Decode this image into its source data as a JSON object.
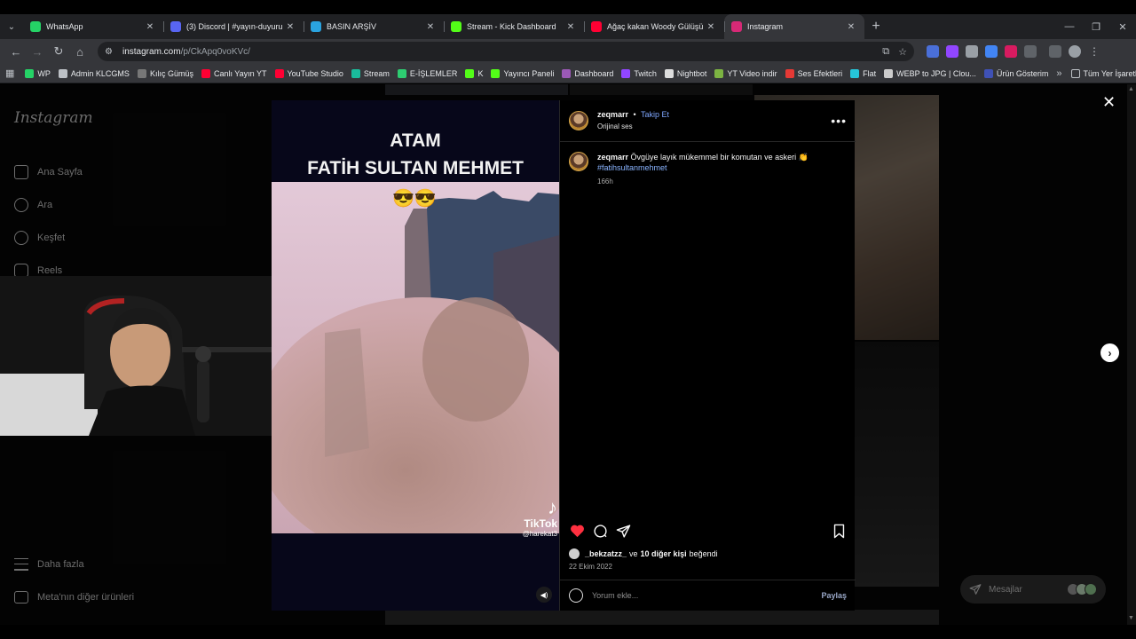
{
  "browser": {
    "tabs": [
      {
        "title": "WhatsApp",
        "icon": "whatsapp-icon",
        "color": "#25d366",
        "active": false
      },
      {
        "title": "(3) Discord | #yayın-duyuru",
        "icon": "discord-icon",
        "color": "#5865f2",
        "active": false
      },
      {
        "title": "BASIN ARŞİV",
        "icon": "telegram-icon",
        "color": "#2aa3df",
        "active": false
      },
      {
        "title": "Stream - Kick Dashboard",
        "icon": "kick-icon",
        "color": "#53fc18",
        "active": false
      },
      {
        "title": "Ağaç kakan Woody Gülüşü - Yo",
        "icon": "youtube-icon",
        "color": "#ff0033",
        "active": false
      },
      {
        "title": "Instagram",
        "icon": "instagram-icon",
        "color": "#d62976",
        "active": true
      }
    ],
    "address": {
      "host": "instagram.com",
      "path": "/p/CkApq0voKVc/"
    },
    "bookmarks": [
      {
        "label": "WP",
        "color": "#25d366"
      },
      {
        "label": "Admin KLCGMS",
        "color": "#bdc1c6"
      },
      {
        "label": "Kılıç Gümüş",
        "color": "#777777"
      },
      {
        "label": "Canlı Yayın YT",
        "color": "#ff0033"
      },
      {
        "label": "YouTube Studio",
        "color": "#ff0033"
      },
      {
        "label": "Stream",
        "color": "#1abc9c"
      },
      {
        "label": "E-İŞLEMLER",
        "color": "#2ecc71"
      },
      {
        "label": "K",
        "color": "#53fc18"
      },
      {
        "label": "Yayıncı Paneli",
        "color": "#53fc18"
      },
      {
        "label": "Dashboard",
        "color": "#9b59b6"
      },
      {
        "label": "Twitch",
        "color": "#9146ff"
      },
      {
        "label": "Nightbot",
        "color": "#dddddd"
      },
      {
        "label": "YT Video indir",
        "color": "#7cb342"
      },
      {
        "label": "Ses Efektleri",
        "color": "#e53935"
      },
      {
        "label": "Flat",
        "color": "#26c6da"
      },
      {
        "label": "WEBP to JPG | Clou...",
        "color": "#cccccc"
      },
      {
        "label": "Ürün Gösterim",
        "color": "#3f51b5"
      }
    ],
    "bookmarks_more": "»",
    "all_bookmarks": "Tüm Yer İşaretleri"
  },
  "instagram": {
    "logo": "Instagram",
    "nav": [
      {
        "label": "Ana Sayfa",
        "icon": "home-icon"
      },
      {
        "label": "Ara",
        "icon": "search-icon"
      },
      {
        "label": "Keşfet",
        "icon": "compass-icon"
      },
      {
        "label": "Reels",
        "icon": "reels-icon"
      }
    ],
    "bottom_nav": [
      {
        "label": "Daha fazla",
        "icon": "menu-icon"
      },
      {
        "label": "Meta'nın diğer ürünleri",
        "icon": "meta-icon"
      }
    ],
    "messages_label": "Mesajlar"
  },
  "post": {
    "overlay_line1": "ATAM",
    "overlay_line2": "FATİH SULTAN MEHMET",
    "overlay_emoji": "😎😎",
    "watermark": "TikTok",
    "watermark_handle": "@harekat3",
    "author": "zeqmarr",
    "separator": "•",
    "follow_label": "Takip Et",
    "audio": "Orijinal ses",
    "more": "•••",
    "caption_user": "zeqmarr",
    "caption_text": "Övgüye layık mükemmel bir komutan ve askeri 👏",
    "hashtag": "#fatihsultanmehmet",
    "caption_age": "166h",
    "likes_user": "_bekzatzz_",
    "likes_connector": "ve",
    "likes_others": "10 diğer kişi",
    "likes_suffix": "beğendi",
    "date": "22 Ekim 2022",
    "comment_placeholder": "Yorum ekle...",
    "share_label": "Paylaş",
    "liked": true
  },
  "colors": {
    "like": "#ff3040",
    "link": "#7fa7ff"
  }
}
